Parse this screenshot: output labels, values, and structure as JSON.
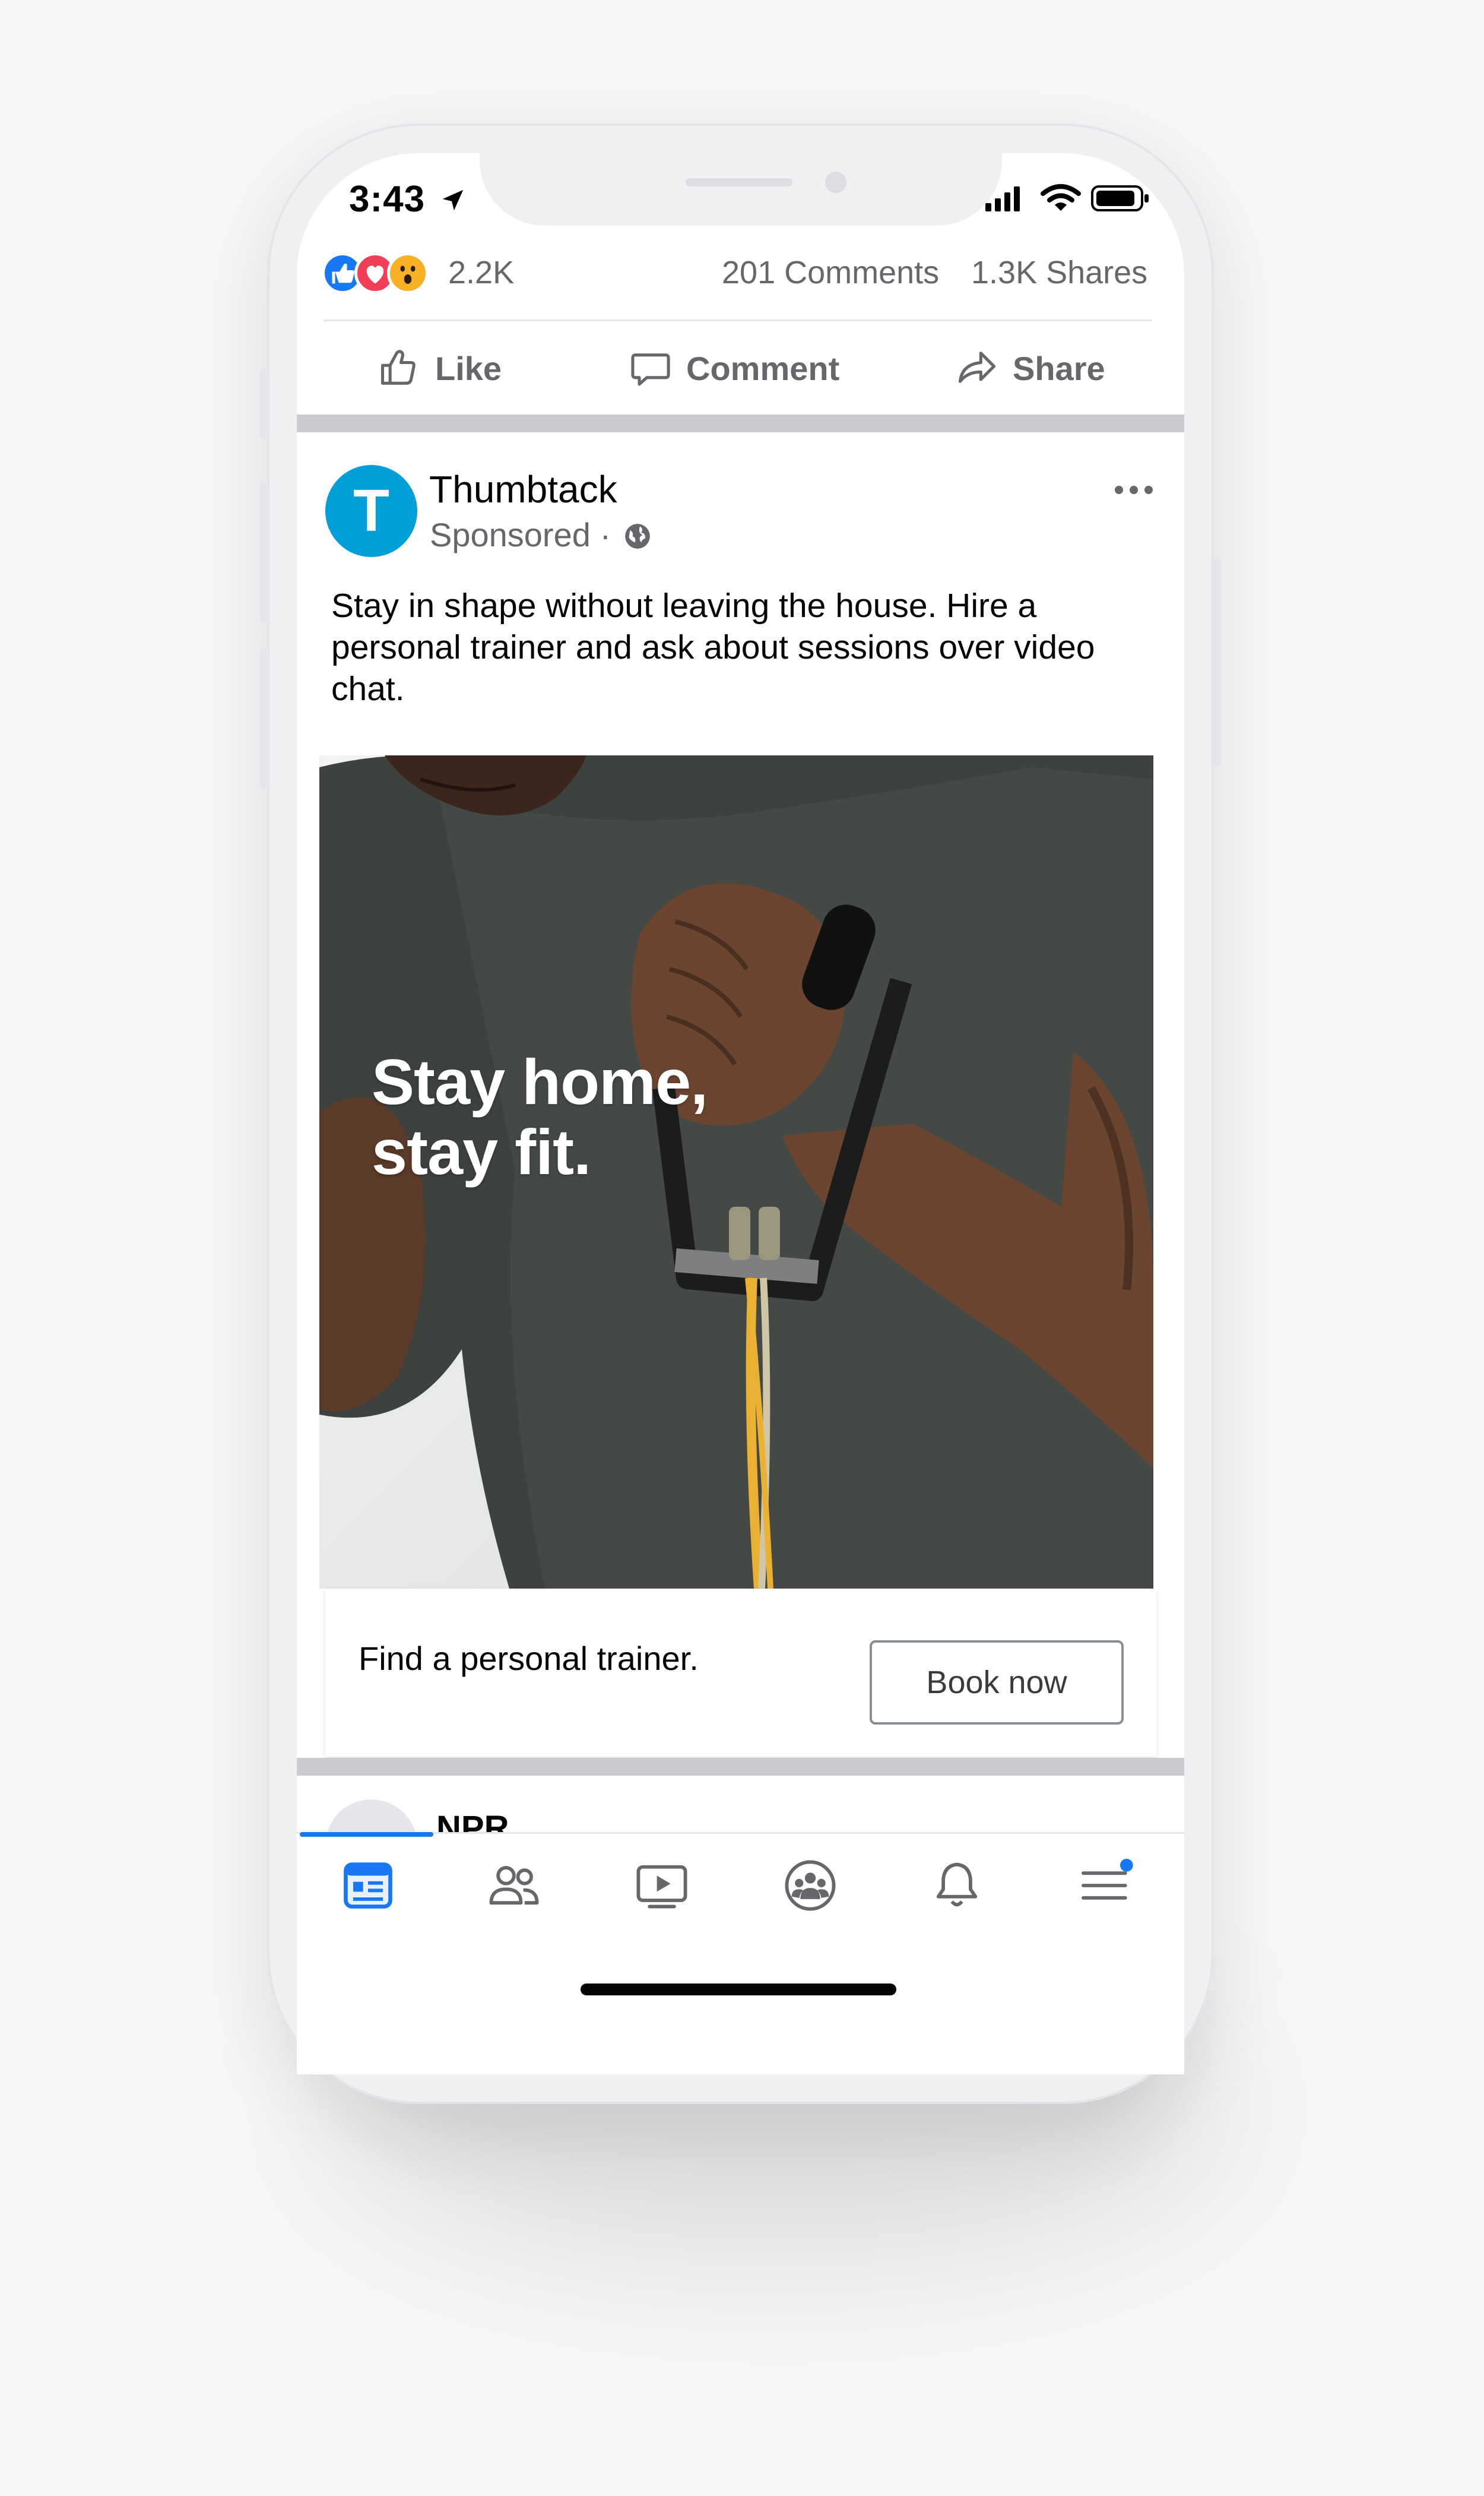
{
  "status_bar": {
    "time": "3:43"
  },
  "engagement": {
    "reaction_count": "2.2K",
    "comments": "201 Comments",
    "shares": "1.3K Shares"
  },
  "actions": {
    "like": "Like",
    "comment": "Comment",
    "share": "Share"
  },
  "post": {
    "page_name": "Thumbtack",
    "sponsored": "Sponsored",
    "avatar_letter": "T",
    "body": "Stay in shape without leaving the house. Hire a personal trainer and ask about sessions over video chat.",
    "image_headline_line1": "Stay home,",
    "image_headline_line2": "stay fit.",
    "cta_text": "Find a personal trainer.",
    "cta_button": "Book now"
  },
  "next_post": {
    "page_name": "NPR"
  },
  "bottom_nav": {
    "items": [
      "home-icon",
      "friends-icon",
      "watch-icon",
      "groups-icon",
      "notifications-icon",
      "menu-icon"
    ],
    "active": "home-icon"
  },
  "colors": {
    "brand_blue": "#1877f2",
    "thumbtack_blue": "#009fd9",
    "like_blue": "#1877f2",
    "love_red": "#f33e58",
    "wow_yellow": "#f7b125"
  }
}
